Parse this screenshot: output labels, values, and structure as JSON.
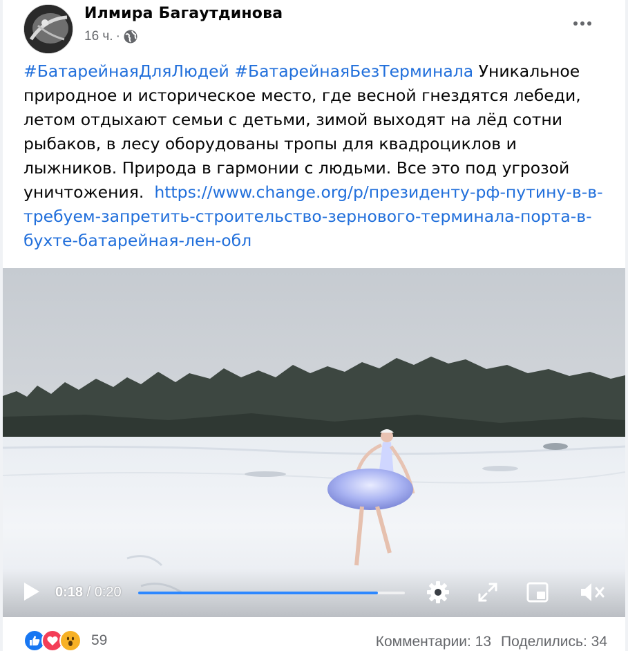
{
  "post": {
    "author": "Илмира Багаутдинова",
    "time": "16 ч.",
    "separator": "·",
    "privacy_icon": "globe-icon",
    "menu_icon": "more-options-icon",
    "hashtag_1": "#БатарейнаяДляЛюдей",
    "hashtag_2": "#БатарейнаяБезТерминала",
    "text": "Уникальное природное и историческое место, где весной гнездятся лебеди, летом отдыхают семьи с детьми, зимой выходят на лёд сотни рыбаков, в лесу оборудованы тропы для квадроциклов и лыжников. Природа в гармонии с людьми. Все это под угрозой уничтожения.",
    "link": "https://www.change.org/p/президенту-рф-путину-в-в-требуем-запретить-строительство-зернового-терминала-порта-в-бухте-батарейная-лен-обл"
  },
  "video": {
    "current_time": "0:18",
    "time_separator": " / ",
    "duration": "0:20",
    "progress": 0.9,
    "icons": [
      "play-icon",
      "settings-gear-icon",
      "fullscreen-icon",
      "picture-in-picture-icon",
      "muted-speaker-icon"
    ]
  },
  "footer": {
    "reaction_icons": [
      "like-icon",
      "love-icon",
      "wow-icon"
    ],
    "reaction_count": "59",
    "comments": "Комментарии: 13",
    "shares": "Поделились: 34"
  },
  "colors": {
    "link": "#216fdb",
    "progress": "#2d88ff",
    "like": "#1877f2",
    "love": "#f33e58",
    "wow": "#f7b125",
    "secondary_text": "#65676b"
  }
}
